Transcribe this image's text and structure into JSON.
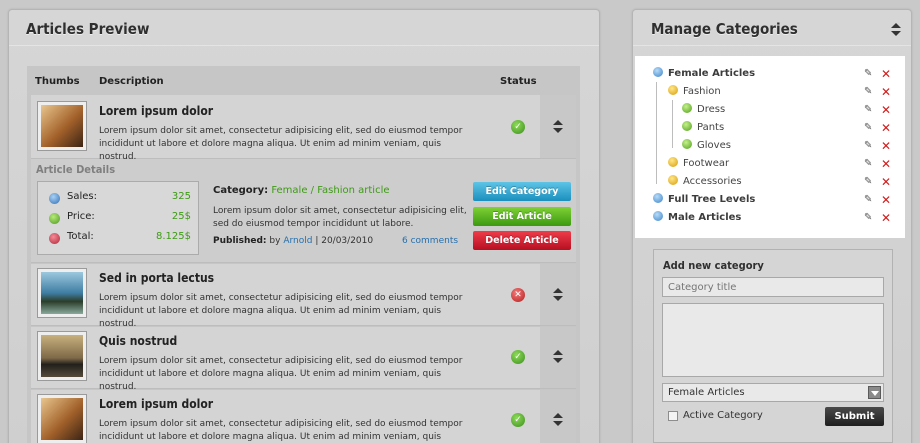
{
  "articles_panel": {
    "title": "Articles Preview",
    "columns": {
      "thumbs": "Thumbs",
      "description": "Description",
      "status": "Status"
    },
    "rows": [
      {
        "title": "Lorem ipsum dolor",
        "desc1": "Lorem ipsum dolor sit amet, consectetur adipisicing elit, sed do eiusmod tempor",
        "desc2": "incididunt ut labore et dolore magna aliqua. Ut enim ad minim veniam, quis nostrud.",
        "status": "published",
        "thumb": "tree-sunset-photo"
      },
      {
        "title": "Sed in porta lectus",
        "desc1": "Lorem ipsum dolor sit amet, consectetur adipisicing elit, sed do eiusmod tempor",
        "desc2": "incididunt ut labore et dolore magna aliqua. Ut enim ad minim veniam, quis nostrud.",
        "status": "unpublished",
        "thumb": "coast-photo"
      },
      {
        "title": "Quis nostrud",
        "desc1": "Lorem ipsum dolor sit amet, consectetur adipisicing elit, sed do eiusmod tempor",
        "desc2": "incididunt ut labore et dolore magna aliqua. Ut enim ad minim veniam, quis nostrud.",
        "status": "published",
        "thumb": "city-skyline-photo"
      },
      {
        "title": "Lorem ipsum dolor",
        "desc1": "Lorem ipsum dolor sit amet, consectetur adipisicing elit, sed do eiusmod tempor",
        "desc2": "incididunt ut labore et dolore magna aliqua. Ut enim ad minim veniam, quis nostrud.",
        "status": "published",
        "thumb": "tree-sunset-photo"
      }
    ],
    "details": {
      "title": "Article Details",
      "stats": [
        {
          "label": "Sales:",
          "value": "325",
          "icon": "blue-ball-icon"
        },
        {
          "label": "Price:",
          "value": "25$",
          "icon": "green-ball-icon"
        },
        {
          "label": "Total:",
          "value": "8.125$",
          "icon": "red-ball-icon"
        }
      ],
      "category_label": "Category:",
      "category_value": "Female / Fashion article",
      "text1": "Lorem ipsum dolor sit amet, consectetur adipisicing elit,",
      "text2": "sed do eiusmod tempor incididunt ut labore.",
      "published_label": "Published:",
      "published_by": "by",
      "author": "Arnold",
      "date": "| 20/03/2010",
      "comments": "6 comments",
      "buttons": {
        "edit_category": "Edit Category",
        "edit_article": "Edit Article",
        "delete_article": "Delete Article"
      }
    }
  },
  "categories_panel": {
    "title": "Manage Categories",
    "items": [
      {
        "label": "Female Articles",
        "level": 0,
        "bold": true,
        "ball": "blue"
      },
      {
        "label": "Fashion",
        "level": 1,
        "bold": false,
        "ball": "yellow"
      },
      {
        "label": "Dress",
        "level": 2,
        "bold": false,
        "ball": "green"
      },
      {
        "label": "Pants",
        "level": 2,
        "bold": false,
        "ball": "green"
      },
      {
        "label": "Gloves",
        "level": 2,
        "bold": false,
        "ball": "green"
      },
      {
        "label": "Footwear",
        "level": 1,
        "bold": false,
        "ball": "yellow"
      },
      {
        "label": "Accessories",
        "level": 1,
        "bold": false,
        "ball": "yellow"
      },
      {
        "label": "Full Tree Levels",
        "level": 0,
        "bold": true,
        "ball": "blue"
      },
      {
        "label": "Male Articles",
        "level": 0,
        "bold": true,
        "ball": "blue"
      }
    ],
    "form": {
      "title": "Add new category",
      "title_placeholder": "Category title",
      "select_value": "Female Articles",
      "checkbox_label": "Active Category",
      "submit": "Submit"
    },
    "colors": {
      "delete": "#d21c1c",
      "link_green": "#3d9b14",
      "link_blue": "#2670ad"
    }
  }
}
